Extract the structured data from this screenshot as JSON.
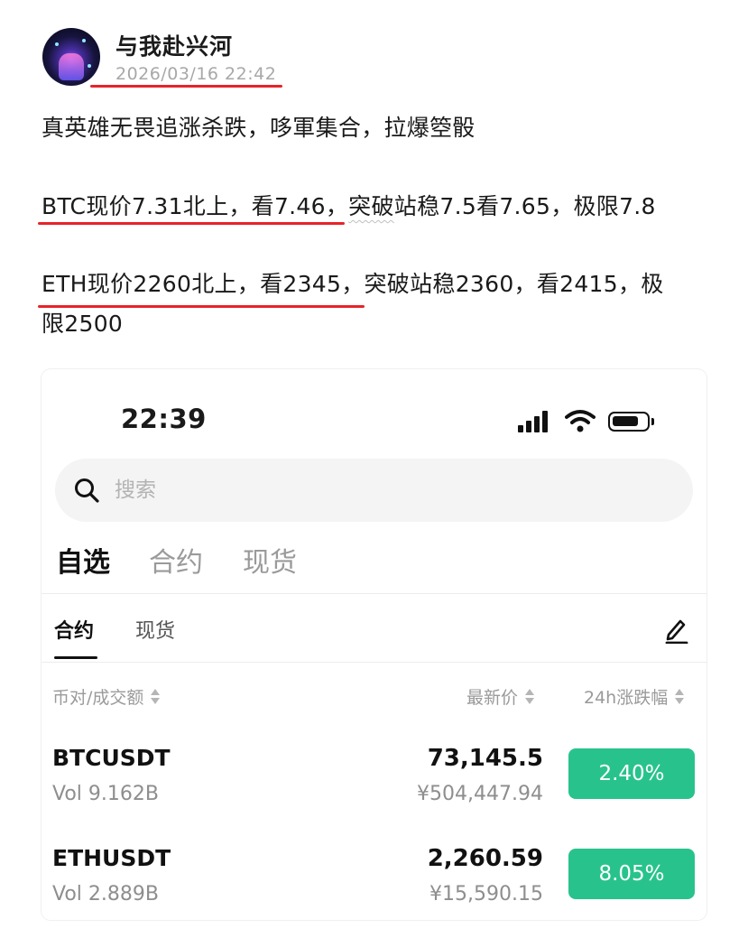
{
  "post": {
    "author": "与我赴兴河",
    "timestamp": "2026/03/16 22:42",
    "line1": "真英雄无畏追涨杀跌，哆軍集合，拉爆箜骰",
    "btc_a": "BTC现价7.31北上，看7.46，",
    "btc_b": "突破",
    "btc_c": "站稳7.5看7.65，极限7.8",
    "eth_a": "ETH现价2260北上，看2345，突破站稳2360，看2415，极",
    "eth_b": "限2500",
    "underline_color": "#e8232a"
  },
  "app": {
    "status_time": "22:39",
    "search_placeholder": "搜索",
    "tabs": [
      "自选",
      "合约",
      "现货"
    ],
    "subtabs": [
      "合约",
      "现货"
    ],
    "columns": {
      "pair": "币对/成交额",
      "price": "最新价",
      "change": "24h涨跌幅"
    },
    "rows": [
      {
        "symbol": "BTCUSDT",
        "volume": "Vol 9.162B",
        "price": "73,145.5",
        "cny": "¥504,447.94",
        "change": "2.40%"
      },
      {
        "symbol": "ETHUSDT",
        "volume": "Vol 2.889B",
        "price": "2,260.59",
        "cny": "¥15,590.15",
        "change": "8.05%"
      }
    ],
    "accent_green": "#28c38c"
  }
}
